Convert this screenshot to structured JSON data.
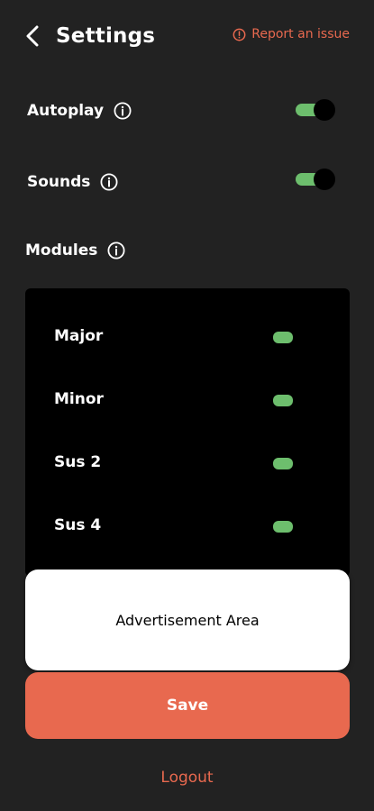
{
  "header": {
    "title": "Settings",
    "report_link": "Report an issue"
  },
  "settings": {
    "autoplay": {
      "label": "Autoplay",
      "enabled": true
    },
    "sounds": {
      "label": "Sounds",
      "enabled": true
    }
  },
  "modules": {
    "label": "Modules",
    "items": [
      {
        "label": "Major",
        "enabled": true
      },
      {
        "label": "Minor",
        "enabled": true
      },
      {
        "label": "Sus 2",
        "enabled": true
      },
      {
        "label": "Sus 4",
        "enabled": true
      }
    ]
  },
  "ad": {
    "label": "Advertisement Area"
  },
  "actions": {
    "save_label": "Save",
    "logout_label": "Logout"
  },
  "colors": {
    "background": "#222222",
    "accent": "#E8694F",
    "toggle_on": "#6DBE6D",
    "card": "#000000"
  }
}
